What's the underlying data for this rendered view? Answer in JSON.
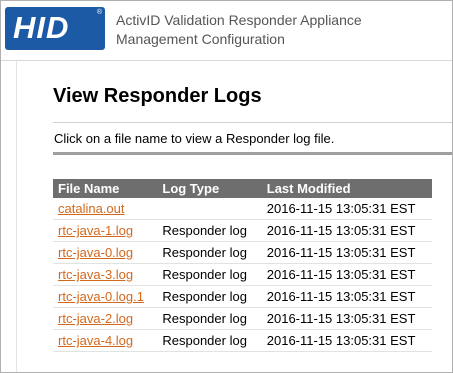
{
  "header": {
    "logo_text": "HID",
    "logo_mark": "®",
    "title_line1": "ActivID Validation Responder Appliance",
    "title_line2": "Management Configuration"
  },
  "page": {
    "title": "View Responder Logs",
    "intro": "Click on a file name to view a Responder log file."
  },
  "table": {
    "headers": [
      "File Name",
      "Log Type",
      "Last Modified"
    ],
    "rows": [
      {
        "file": "catalina.out",
        "type": "",
        "modified": "2016-11-15 13:05:31 EST"
      },
      {
        "file": "rtc-java-1.log",
        "type": "Responder log",
        "modified": "2016-11-15 13:05:31 EST"
      },
      {
        "file": "rtc-java-0.log",
        "type": "Responder log",
        "modified": "2016-11-15 13:05:31 EST"
      },
      {
        "file": "rtc-java-3.log",
        "type": "Responder log",
        "modified": "2016-11-15 13:05:31 EST"
      },
      {
        "file": "rtc-java-0.log.1",
        "type": "Responder log",
        "modified": "2016-11-15 13:05:31 EST"
      },
      {
        "file": "rtc-java-2.log",
        "type": "Responder log",
        "modified": "2016-11-15 13:05:31 EST"
      },
      {
        "file": "rtc-java-4.log",
        "type": "Responder log",
        "modified": "2016-11-15 13:05:31 EST"
      }
    ]
  },
  "colors": {
    "brand": "#1d5aa6",
    "link": "#d2691e",
    "table_header": "#6e6e6e"
  }
}
